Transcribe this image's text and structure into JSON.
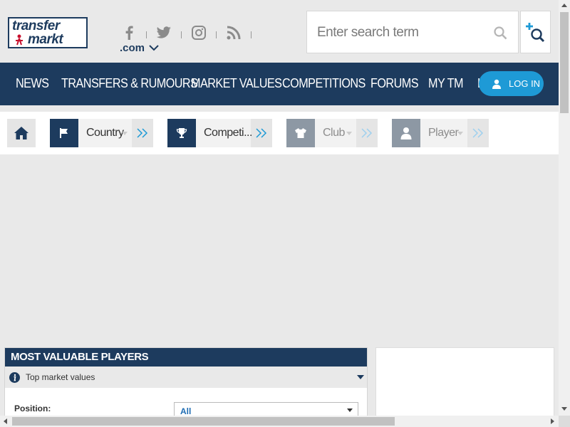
{
  "header": {
    "logo_line1": "transfer",
    "logo_line2": "markt",
    "social": [
      "facebook-icon",
      "twitter-icon",
      "instagram-icon",
      "rss-icon"
    ],
    "domain": ".com",
    "search_placeholder": "Enter search term"
  },
  "nav": {
    "items": [
      "NEWS",
      "TRANSFERS & RUMOURS",
      "MARKET VALUES",
      "COMPETITIONS",
      "FORUMS",
      "MY TM",
      "L"
    ],
    "login": "LOG IN"
  },
  "filters": [
    {
      "label": "Country",
      "icon": "flag-icon"
    },
    {
      "label": "Competi...",
      "icon": "trophy-icon"
    },
    {
      "label": "Club",
      "icon": "shirt-icon"
    },
    {
      "label": "Player",
      "icon": "person-icon"
    }
  ],
  "mvp": {
    "title": "MOST VALUABLE PLAYERS",
    "subtitle": "Top market values",
    "position_label": "Position:",
    "position_value": "All"
  },
  "colors": {
    "navy": "#1d3b5e",
    "accent": "#1e9ad6"
  }
}
